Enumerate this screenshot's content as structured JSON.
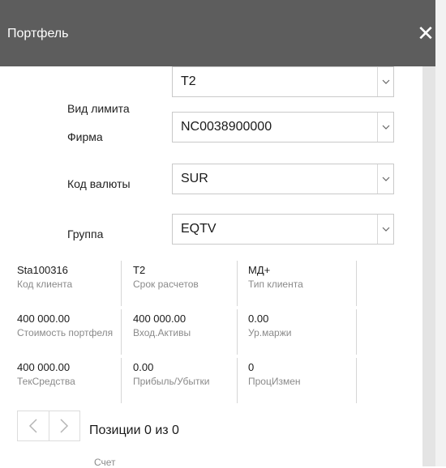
{
  "header": {
    "title": "Портфель",
    "close_glyph": "✕"
  },
  "form": {
    "limit_type": {
      "label": "Вид лимита",
      "value": "T2"
    },
    "firm": {
      "label": "Фирма",
      "value": "NC0038900000"
    },
    "currency": {
      "label": "Код валюты",
      "value": "SUR"
    },
    "group": {
      "label": "Группа",
      "value": "EQTV"
    }
  },
  "info": {
    "row1": [
      {
        "value": "Sta100316",
        "label": "Код клиента"
      },
      {
        "value": "T2",
        "label": "Срок расчетов"
      },
      {
        "value": "МД+",
        "label": "Тип клиента"
      }
    ],
    "row2": [
      {
        "value": "400 000.00",
        "label": "Стоимость портфеля"
      },
      {
        "value": "400 000.00",
        "label": "Вход.Активы"
      },
      {
        "value": "0.00",
        "label": "Ур.маржи"
      }
    ],
    "row3": [
      {
        "value": "400 000.00",
        "label": "ТекСредства"
      },
      {
        "value": "0.00",
        "label": "Прибыль/Убытки"
      },
      {
        "value": "0",
        "label": "ПроцИзмен"
      }
    ]
  },
  "positions": {
    "label": "Позиции 0 из 0",
    "column_account": "Счет"
  },
  "icons": {
    "close": "close-icon",
    "dropdown": "chevron-down-icon",
    "prev": "chevron-left-icon",
    "next": "chevron-right-icon"
  },
  "colors": {
    "header_bg": "#5d5d5d",
    "label_gray": "#8a8a8a",
    "border": "#c9c9c9"
  }
}
